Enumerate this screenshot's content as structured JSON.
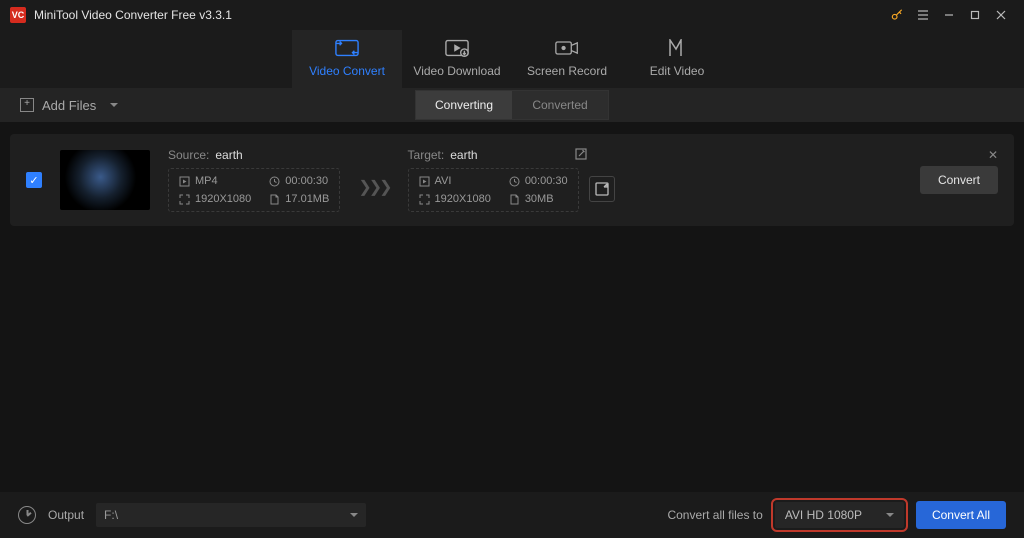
{
  "titlebar": {
    "logo_text": "VC",
    "title": "MiniTool Video Converter Free v3.3.1"
  },
  "maintabs": {
    "convert": "Video Convert",
    "download": "Video Download",
    "record": "Screen Record",
    "edit": "Edit Video"
  },
  "subheader": {
    "add_files": "Add Files",
    "converting": "Converting",
    "converted": "Converted"
  },
  "file": {
    "source_label": "Source:",
    "source_name": "earth",
    "target_label": "Target:",
    "target_name": "earth",
    "src_format": "MP4",
    "src_duration": "00:00:30",
    "src_resolution": "1920X1080",
    "src_size": "17.01MB",
    "tgt_format": "AVI",
    "tgt_duration": "00:00:30",
    "tgt_resolution": "1920X1080",
    "tgt_size": "30MB",
    "convert_btn": "Convert"
  },
  "bottom": {
    "output_label": "Output",
    "output_path": "F:\\",
    "convert_all_to": "Convert all files to",
    "preset": "AVI HD 1080P",
    "convert_all": "Convert All"
  }
}
